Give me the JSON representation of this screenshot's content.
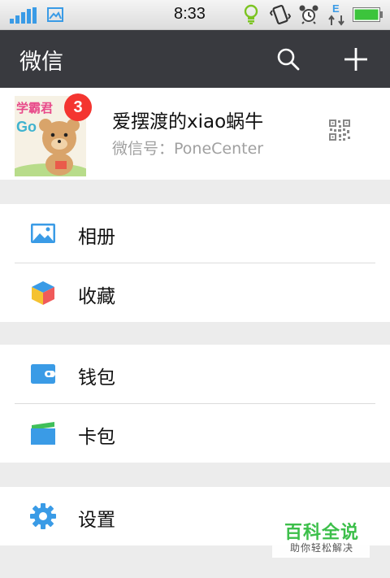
{
  "status_bar": {
    "time": "8:33",
    "data_indicator": "E",
    "icons": [
      "signal-icon",
      "image-notification-icon",
      "lightbulb-icon",
      "vibrate-icon",
      "alarm-icon",
      "mobile-data-icon",
      "battery-icon"
    ]
  },
  "header": {
    "title": "微信",
    "icons": [
      "search-icon",
      "plus-icon"
    ]
  },
  "profile": {
    "name": "爱摆渡的xiao蜗牛",
    "wechat_id": "微信号：PoneCenter",
    "badge_count": "3",
    "avatar_text": {
      "top": "学霸君",
      "go": "Go"
    }
  },
  "menu": {
    "album": "相册",
    "favorites": "收藏",
    "wallet": "钱包",
    "cards": "卡包",
    "settings": "设置"
  },
  "watermark": {
    "main": "百科全说",
    "sub": "助你轻松解决"
  },
  "colors": {
    "header_bg": "#393a3f",
    "badge": "#f43530",
    "accent_blue": "#3a9be6",
    "watermark_green": "#3cbf4a",
    "battery_green": "#3cc43c"
  }
}
